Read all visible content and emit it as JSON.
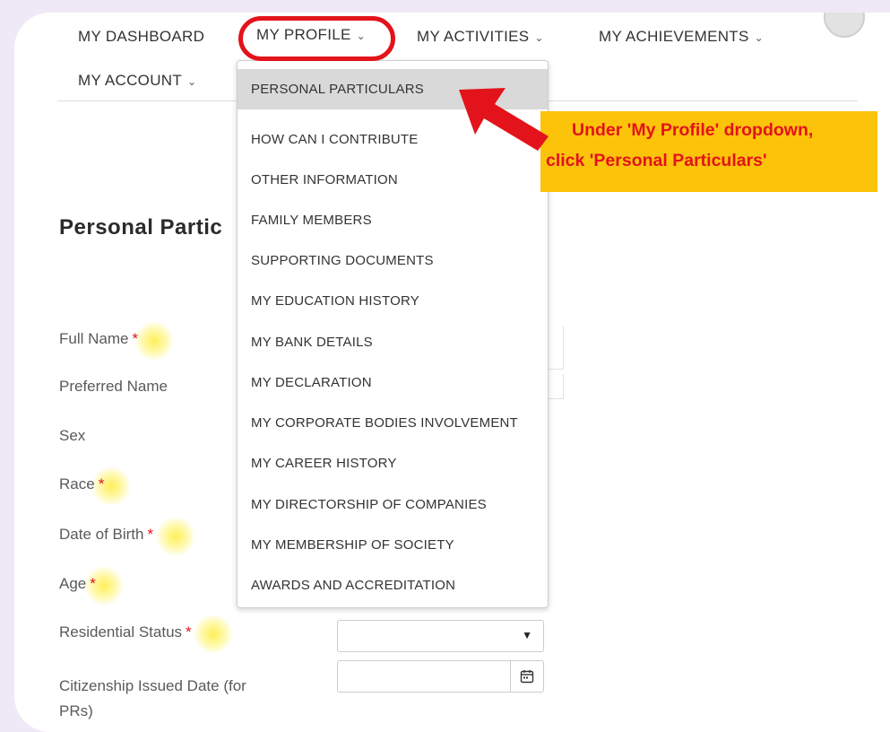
{
  "nav": {
    "dashboard": "MY DASHBOARD",
    "profile": "MY PROFILE",
    "activities": "MY ACTIVITIES",
    "achievements": "MY ACHIEVEMENTS",
    "account": "MY ACCOUNT",
    "chevron": "⌄"
  },
  "dropdown": {
    "items": [
      "PERSONAL PARTICULARS",
      "HOW CAN I CONTRIBUTE",
      "OTHER INFORMATION",
      "FAMILY MEMBERS",
      "SUPPORTING DOCUMENTS",
      "MY EDUCATION HISTORY",
      "MY BANK DETAILS",
      "MY DECLARATION",
      "MY CORPORATE BODIES INVOLVEMENT",
      "MY CAREER HISTORY",
      "MY DIRECTORSHIP OF COMPANIES",
      "MY MEMBERSHIP OF SOCIETY",
      "AWARDS AND ACCREDITATION"
    ]
  },
  "page": {
    "title": "Personal Partic"
  },
  "form": {
    "required_mark": "*",
    "full_name": "Full Name",
    "preferred_name": "Preferred Name",
    "sex": "Sex",
    "race": "Race",
    "dob": "Date of Birth",
    "age": "Age",
    "residential_status": "Residential Status",
    "citizenship_line1": "Citizenship Issued Date (for",
    "citizenship_line2": "PRs)",
    "select_caret": "▼"
  },
  "callout": {
    "line1": "Under 'My Profile' dropdown,",
    "line2": "click 'Personal Particulars'"
  },
  "colors": {
    "annotation_red": "#e3131b",
    "callout_yellow": "#fcc30b",
    "active_item_bg": "#d9d9d9",
    "page_bg": "#efe9f7"
  }
}
